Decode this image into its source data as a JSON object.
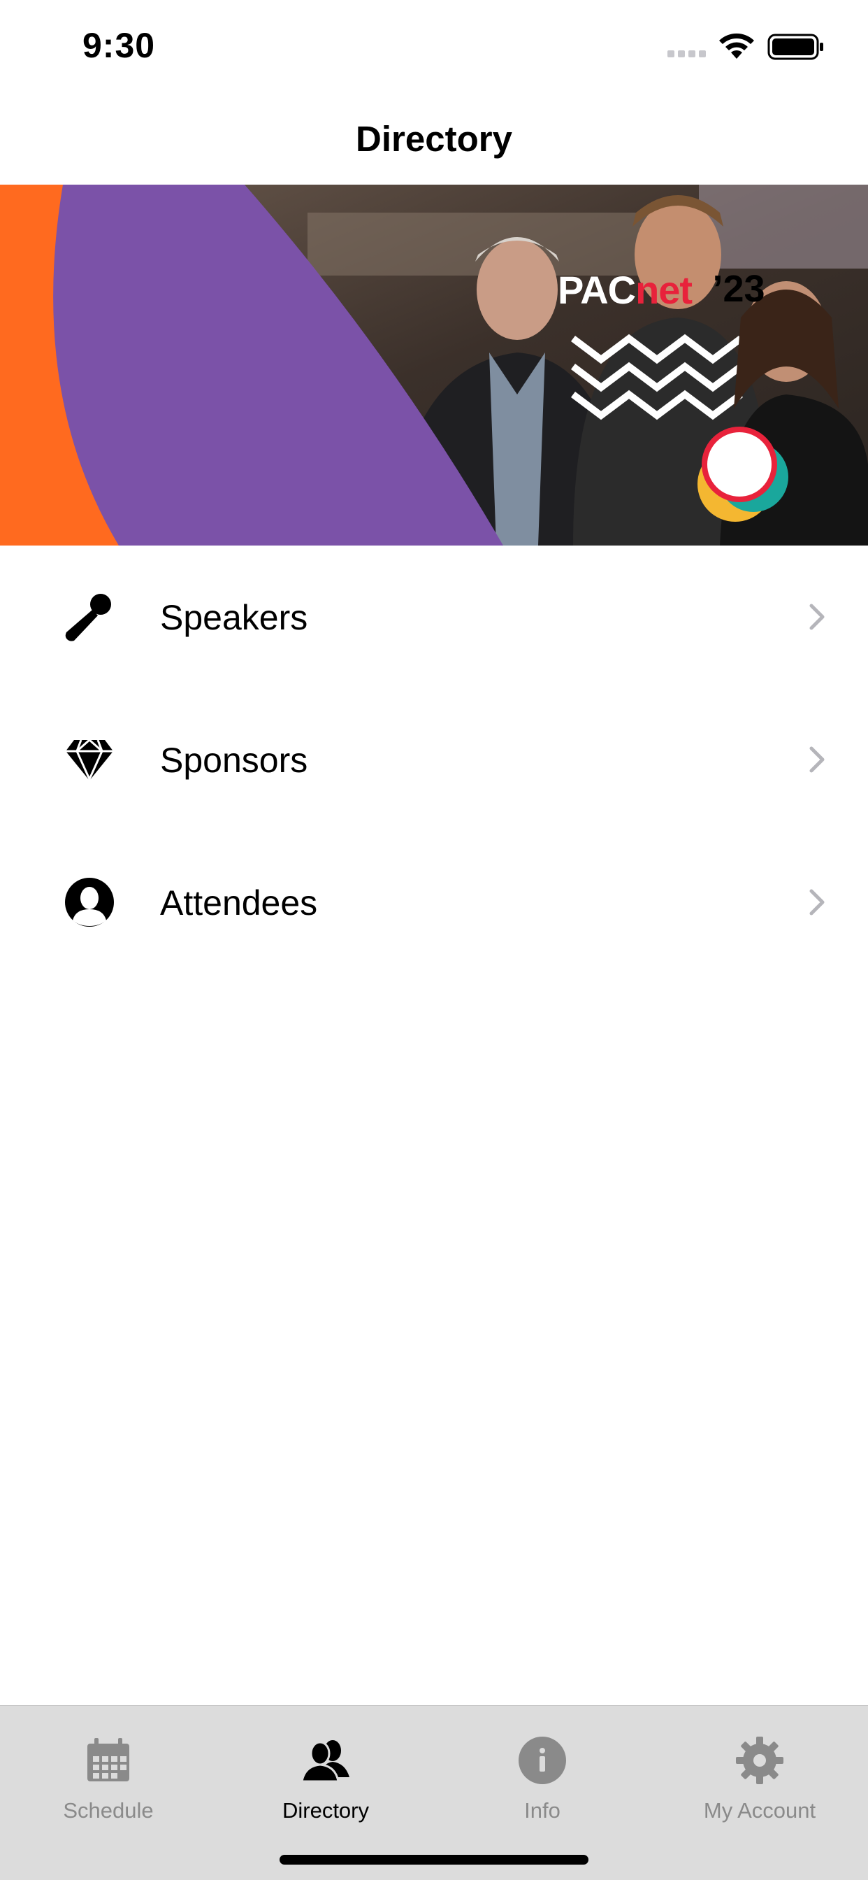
{
  "status_bar": {
    "time": "9:30"
  },
  "nav": {
    "title": "Directory"
  },
  "banner": {
    "logo_main": "PAC",
    "logo_accent": "net",
    "logo_year": "’23",
    "colors": {
      "orange": "#ff6a1f",
      "purple": "#7b52a8"
    }
  },
  "menu": {
    "items": [
      {
        "label": "Speakers",
        "icon": "microphone-icon"
      },
      {
        "label": "Sponsors",
        "icon": "diamond-icon"
      },
      {
        "label": "Attendees",
        "icon": "person-circle-icon"
      }
    ]
  },
  "tab_bar": {
    "tabs": [
      {
        "label": "Schedule",
        "icon": "calendar-icon",
        "active": false
      },
      {
        "label": "Directory",
        "icon": "people-icon",
        "active": true
      },
      {
        "label": "Info",
        "icon": "info-icon",
        "active": false
      },
      {
        "label": "My Account",
        "icon": "gear-icon",
        "active": false
      }
    ]
  }
}
